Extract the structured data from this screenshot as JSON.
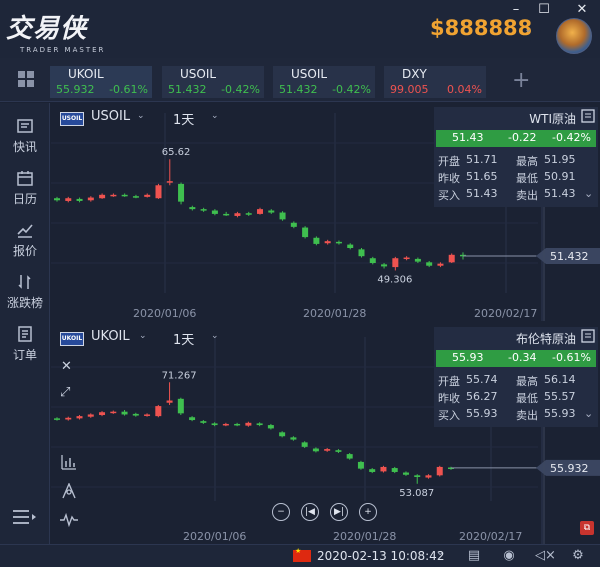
{
  "app": {
    "logo_text": "交易侠",
    "logo_subtext": "TRADER MASTER",
    "balance": "$888888",
    "window_controls": {
      "minimize": "–",
      "maximize": "☐",
      "close": "✕"
    }
  },
  "quote_strip": {
    "cards": [
      {
        "symbol": "UKOIL",
        "price": "55.932",
        "change": "-0.61%",
        "direction": "up",
        "active": true
      },
      {
        "symbol": "USOIL",
        "price": "51.432",
        "change": "-0.42%",
        "direction": "up",
        "active": false
      },
      {
        "symbol": "USOIL",
        "price": "51.432",
        "change": "-0.42%",
        "direction": "up",
        "active": false
      },
      {
        "symbol": "DXY",
        "price": "99.005",
        "change": "0.04%",
        "direction": "down",
        "active": false
      }
    ],
    "add_label": "+"
  },
  "sidebar": {
    "items": [
      {
        "label": "快讯",
        "icon": "news-icon"
      },
      {
        "label": "日历",
        "icon": "calendar-icon"
      },
      {
        "label": "报价",
        "icon": "quote-chart-icon"
      },
      {
        "label": "涨跌榜",
        "icon": "up-down-icon"
      },
      {
        "label": "订单",
        "icon": "order-icon"
      }
    ],
    "menu_icon": "expand-menu-icon"
  },
  "colors": {
    "up": "#3fbf4f",
    "down": "#ef5350",
    "accent": "#f0a332",
    "background": "#1b2233"
  },
  "panels": [
    {
      "symbol_badge": "USOIL",
      "symbol": "USOIL",
      "timeframe": "1天",
      "info": {
        "title": "WTI原油",
        "price": "51.43",
        "change": "-0.22",
        "change_pct": "-0.42%",
        "open_label": "开盘",
        "open": "51.71",
        "high_label": "最高",
        "high": "51.95",
        "prev_label": "昨收",
        "prev": "51.65",
        "low_label": "最低",
        "low": "50.91",
        "buy_label": "买入",
        "buy": "51.43",
        "sell_label": "卖出",
        "sell": "51.43"
      },
      "x_labels": [
        "2020/01/06",
        "2020/01/28",
        "2020/02/17"
      ],
      "last_price_tag": "51.432",
      "high_annotation": "65.62",
      "low_annotation": "49.306"
    },
    {
      "symbol_badge": "UKOIL",
      "symbol": "UKOIL",
      "timeframe": "1天",
      "info": {
        "title": "布伦特原油",
        "price": "55.93",
        "change": "-0.34",
        "change_pct": "-0.61%",
        "open_label": "开盘",
        "open": "55.74",
        "high_label": "最高",
        "high": "56.14",
        "prev_label": "昨收",
        "prev": "56.27",
        "low_label": "最低",
        "low": "55.57",
        "buy_label": "买入",
        "buy": "55.93",
        "sell_label": "卖出",
        "sell": "55.93"
      },
      "x_labels": [
        "2020/01/06",
        "2020/01/28",
        "2020/02/17"
      ],
      "last_price_tag": "55.932",
      "high_annotation": "71.267",
      "low_annotation": "53.087"
    }
  ],
  "chart_data": [
    {
      "type": "candlestick",
      "series_up_color": "#3fbf4f",
      "series_down_color": "#ef5350",
      "ylim": [
        46,
        68
      ],
      "candles": [
        {
          "o": 59.9,
          "c": 59.6,
          "h": 60.1,
          "l": 59.4
        },
        {
          "o": 59.5,
          "c": 59.9,
          "h": 60.1,
          "l": 59.3
        },
        {
          "o": 59.8,
          "c": 59.5,
          "h": 60.0,
          "l": 59.3
        },
        {
          "o": 59.6,
          "c": 60.0,
          "h": 60.2,
          "l": 59.4
        },
        {
          "o": 59.9,
          "c": 60.4,
          "h": 60.6,
          "l": 59.8
        },
        {
          "o": 60.3,
          "c": 60.4,
          "h": 60.6,
          "l": 60.1
        },
        {
          "o": 60.4,
          "c": 60.3,
          "h": 60.6,
          "l": 60.1
        },
        {
          "o": 60.2,
          "c": 60.1,
          "h": 60.4,
          "l": 59.9
        },
        {
          "o": 60.1,
          "c": 60.4,
          "h": 60.6,
          "l": 60.0
        },
        {
          "o": 59.9,
          "c": 61.8,
          "h": 62.0,
          "l": 59.8
        },
        {
          "o": 62.3,
          "c": 62.4,
          "h": 65.62,
          "l": 61.8
        },
        {
          "o": 62.0,
          "c": 59.4,
          "h": 62.2,
          "l": 59.0
        },
        {
          "o": 58.6,
          "c": 58.3,
          "h": 58.8,
          "l": 58.1
        },
        {
          "o": 58.3,
          "c": 58.1,
          "h": 58.5,
          "l": 57.9
        },
        {
          "o": 58.1,
          "c": 57.6,
          "h": 58.3,
          "l": 57.4
        },
        {
          "o": 57.6,
          "c": 57.5,
          "h": 57.9,
          "l": 57.3
        },
        {
          "o": 57.3,
          "c": 57.7,
          "h": 57.9,
          "l": 57.1
        },
        {
          "o": 57.7,
          "c": 57.5,
          "h": 57.9,
          "l": 57.3
        },
        {
          "o": 57.6,
          "c": 58.3,
          "h": 58.5,
          "l": 57.5
        },
        {
          "o": 58.1,
          "c": 57.8,
          "h": 58.3,
          "l": 57.6
        },
        {
          "o": 57.8,
          "c": 56.8,
          "h": 58.0,
          "l": 56.6
        },
        {
          "o": 56.3,
          "c": 55.7,
          "h": 56.5,
          "l": 55.5
        },
        {
          "o": 55.6,
          "c": 54.2,
          "h": 55.8,
          "l": 54.0
        },
        {
          "o": 54.1,
          "c": 53.2,
          "h": 54.3,
          "l": 53.0
        },
        {
          "o": 53.3,
          "c": 53.6,
          "h": 53.8,
          "l": 53.1
        },
        {
          "o": 53.5,
          "c": 53.3,
          "h": 53.7,
          "l": 53.1
        },
        {
          "o": 53.1,
          "c": 52.6,
          "h": 53.3,
          "l": 52.4
        },
        {
          "o": 52.4,
          "c": 51.4,
          "h": 52.6,
          "l": 51.2
        },
        {
          "o": 51.1,
          "c": 50.4,
          "h": 51.3,
          "l": 50.2
        },
        {
          "o": 50.2,
          "c": 49.9,
          "h": 50.4,
          "l": 49.6
        },
        {
          "o": 49.8,
          "c": 51.1,
          "h": 51.3,
          "l": 49.306
        },
        {
          "o": 51.0,
          "c": 51.2,
          "h": 51.4,
          "l": 50.8
        },
        {
          "o": 51.0,
          "c": 50.6,
          "h": 51.2,
          "l": 50.4
        },
        {
          "o": 50.5,
          "c": 50.0,
          "h": 50.7,
          "l": 49.8
        },
        {
          "o": 50.0,
          "c": 50.3,
          "h": 50.5,
          "l": 49.8
        },
        {
          "o": 50.5,
          "c": 51.6,
          "h": 51.8,
          "l": 50.4
        },
        {
          "o": 51.6,
          "c": 51.43,
          "h": 51.95,
          "l": 50.91
        }
      ]
    },
    {
      "type": "candlestick",
      "series_up_color": "#3fbf4f",
      "series_down_color": "#ef5350",
      "ylim": [
        50,
        74
      ],
      "candles": [
        {
          "o": 64.8,
          "c": 64.6,
          "h": 65.0,
          "l": 64.4
        },
        {
          "o": 64.6,
          "c": 64.9,
          "h": 65.1,
          "l": 64.4
        },
        {
          "o": 64.8,
          "c": 65.2,
          "h": 65.4,
          "l": 64.6
        },
        {
          "o": 65.1,
          "c": 65.5,
          "h": 65.7,
          "l": 64.9
        },
        {
          "o": 65.4,
          "c": 65.9,
          "h": 66.1,
          "l": 65.2
        },
        {
          "o": 65.8,
          "c": 66.0,
          "h": 66.2,
          "l": 65.6
        },
        {
          "o": 66.0,
          "c": 65.5,
          "h": 66.3,
          "l": 65.3
        },
        {
          "o": 65.6,
          "c": 65.3,
          "h": 65.8,
          "l": 65.1
        },
        {
          "o": 65.3,
          "c": 65.5,
          "h": 65.7,
          "l": 65.1
        },
        {
          "o": 65.2,
          "c": 67.0,
          "h": 67.2,
          "l": 65.0
        },
        {
          "o": 67.6,
          "c": 68.0,
          "h": 71.267,
          "l": 67.2
        },
        {
          "o": 68.3,
          "c": 65.7,
          "h": 68.5,
          "l": 65.4
        },
        {
          "o": 65.0,
          "c": 64.5,
          "h": 65.2,
          "l": 64.3
        },
        {
          "o": 64.3,
          "c": 64.0,
          "h": 64.5,
          "l": 63.8
        },
        {
          "o": 63.9,
          "c": 63.6,
          "h": 64.1,
          "l": 63.4
        },
        {
          "o": 63.6,
          "c": 63.8,
          "h": 64.0,
          "l": 63.4
        },
        {
          "o": 63.8,
          "c": 63.6,
          "h": 64.0,
          "l": 63.4
        },
        {
          "o": 63.5,
          "c": 64.0,
          "h": 64.2,
          "l": 63.3
        },
        {
          "o": 63.9,
          "c": 63.6,
          "h": 64.1,
          "l": 63.4
        },
        {
          "o": 63.6,
          "c": 63.0,
          "h": 63.8,
          "l": 62.8
        },
        {
          "o": 62.3,
          "c": 61.6,
          "h": 62.5,
          "l": 61.4
        },
        {
          "o": 61.4,
          "c": 61.0,
          "h": 61.6,
          "l": 60.8
        },
        {
          "o": 60.5,
          "c": 59.7,
          "h": 60.7,
          "l": 59.5
        },
        {
          "o": 59.4,
          "c": 58.9,
          "h": 59.6,
          "l": 58.7
        },
        {
          "o": 59.0,
          "c": 59.3,
          "h": 59.5,
          "l": 58.8
        },
        {
          "o": 59.1,
          "c": 58.8,
          "h": 59.3,
          "l": 58.6
        },
        {
          "o": 58.4,
          "c": 57.6,
          "h": 58.6,
          "l": 57.4
        },
        {
          "o": 57.0,
          "c": 55.8,
          "h": 57.2,
          "l": 55.6
        },
        {
          "o": 55.7,
          "c": 55.2,
          "h": 55.9,
          "l": 55.0
        },
        {
          "o": 55.3,
          "c": 56.1,
          "h": 56.3,
          "l": 55.1
        },
        {
          "o": 55.9,
          "c": 55.2,
          "h": 56.1,
          "l": 55.0
        },
        {
          "o": 55.1,
          "c": 54.7,
          "h": 55.3,
          "l": 54.5
        },
        {
          "o": 54.6,
          "c": 54.3,
          "h": 54.8,
          "l": 53.087
        },
        {
          "o": 54.2,
          "c": 54.6,
          "h": 54.8,
          "l": 54.0
        },
        {
          "o": 54.6,
          "c": 56.1,
          "h": 56.3,
          "l": 54.4
        },
        {
          "o": 56.0,
          "c": 55.93,
          "h": 56.14,
          "l": 55.57
        }
      ]
    }
  ],
  "status_bar": {
    "datetime": "2020-02-13 10:08:42",
    "datetime_caret": "⌄"
  }
}
